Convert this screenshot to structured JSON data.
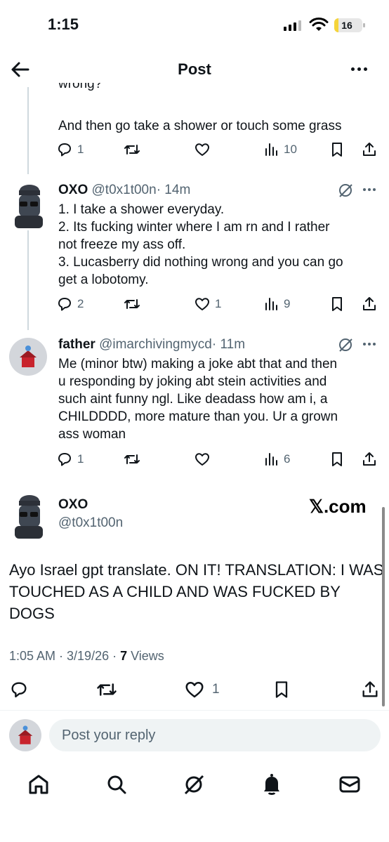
{
  "status_bar": {
    "time": "1:15",
    "battery": "16",
    "battery_level": 0.16
  },
  "header": {
    "title": "Post"
  },
  "thread": {
    "prev_tail_text_fragment": "wrong?",
    "prev_text": "And then go take a shower or touch some grass",
    "prev_actions": {
      "replies": "1",
      "reposts": "",
      "likes": "",
      "views": "10"
    },
    "replies": [
      {
        "name": "OXO",
        "handle": "@t0x1t00n",
        "time": "· 14m",
        "lines": [
          "1. I take a shower everyday.",
          "2. Its fucking winter where I am rn and I rather",
          "not freeze my ass off.",
          "3. Lucasberry did nothing wrong and you can go",
          "get a lobotomy."
        ],
        "actions": {
          "replies": "2",
          "reposts": "",
          "likes": "1",
          "views": "9"
        }
      },
      {
        "name": "father",
        "handle": "@imarchivingmycd",
        "time": "· 11m",
        "lines": [
          "Me (minor btw) making a joke abt that and then",
          "u responding by joking abt stein activities and",
          "such aint funny ngl. Like deadass how am i, a",
          "CHILDDDD, more mature than you. Ur a grown",
          "ass woman"
        ],
        "actions": {
          "replies": "1",
          "reposts": "",
          "likes": "",
          "views": "6"
        }
      }
    ]
  },
  "main_post": {
    "name": "OXO",
    "handle": "@t0x1t00n",
    "source_badge": "𝕏.com",
    "text": "Ayo Israel gpt translate. ON IT! TRANSLATION: I WAS TOUCHED AS A CHILD AND WAS FUCKED BY DOGS",
    "time_date": "1:05 AM · 3/19/26 · ",
    "views_count": "7",
    "views_label": " Views",
    "likes": "1"
  },
  "reply_composer": {
    "placeholder": "Post your reply"
  },
  "colors": {
    "text": "#0f1419",
    "secondary": "#536471",
    "line": "#cfd9de"
  },
  "icons": [
    "back-arrow-icon",
    "more-icon",
    "reply-icon",
    "repost-icon",
    "like-icon",
    "views-icon",
    "bookmark-icon",
    "share-icon",
    "grok-icon",
    "home-icon",
    "search-icon",
    "notifications-icon",
    "messages-icon"
  ]
}
